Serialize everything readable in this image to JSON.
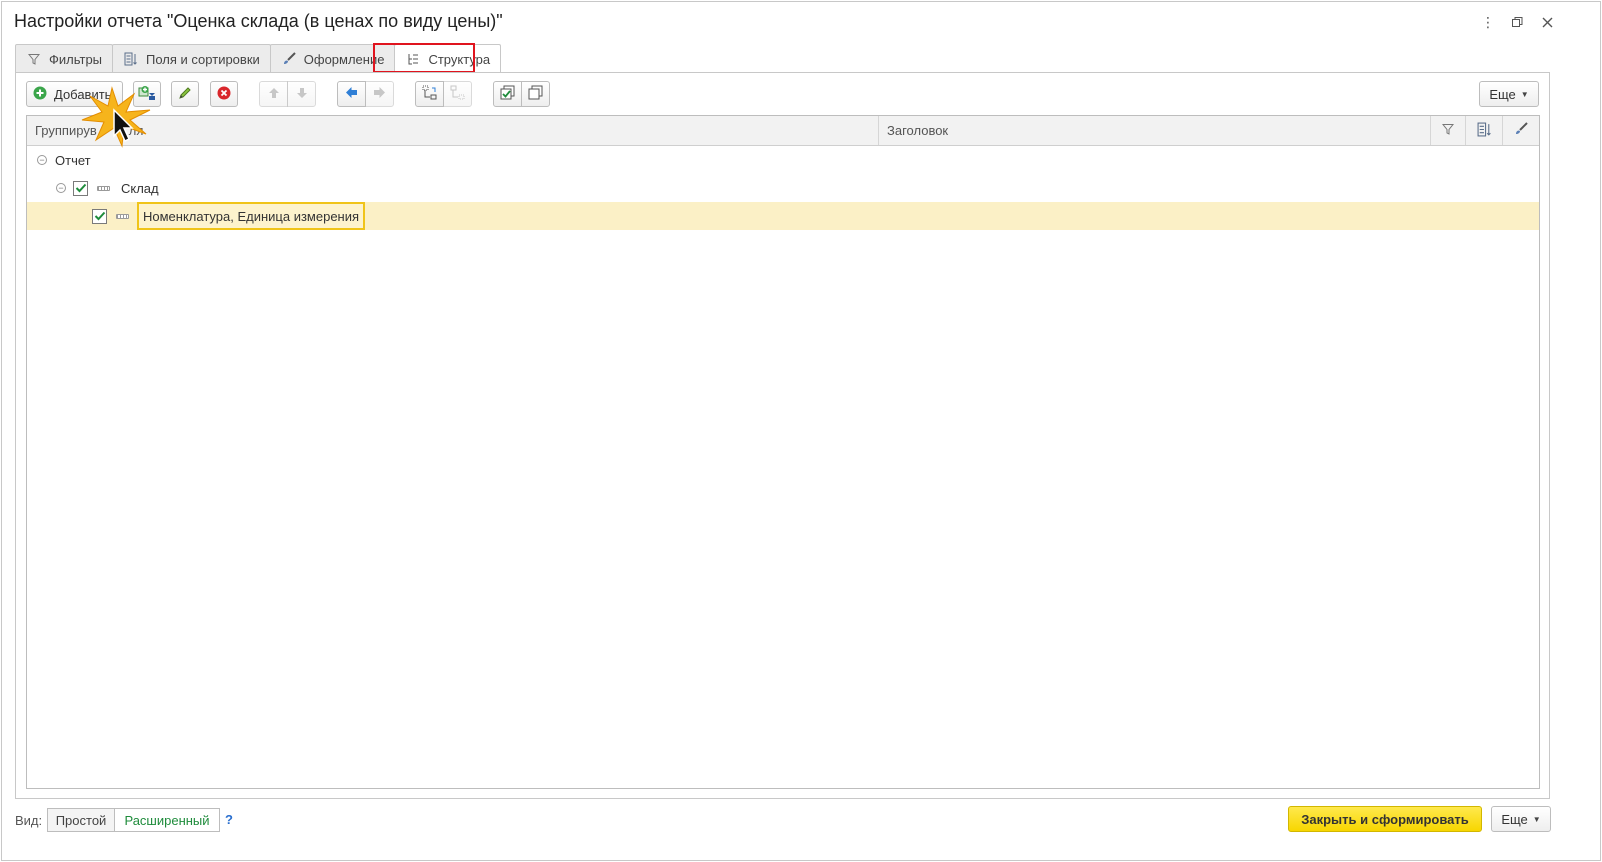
{
  "window": {
    "title": "Настройки отчета \"Оценка склада (в ценах по виду цены)\"",
    "controls": [
      "more-icon",
      "restore-icon",
      "close-icon"
    ]
  },
  "tabs": [
    {
      "label": "Фильтры",
      "icon": "filter-icon"
    },
    {
      "label": "Поля и сортировки",
      "icon": "fields-sort-icon"
    },
    {
      "label": "Оформление",
      "icon": "brush-icon"
    },
    {
      "label": "Структура",
      "icon": "structure-icon",
      "active": true
    }
  ],
  "toolbar": {
    "add_label": "Добавить",
    "more_label": "Еще",
    "icons": [
      "add-icon",
      "add-group-icon",
      "edit-icon",
      "delete-icon",
      "move-up-icon",
      "move-down-icon",
      "move-left-icon",
      "move-right-icon",
      "group-icon",
      "ungroup-icon",
      "check-all-icon",
      "uncheck-all-icon"
    ]
  },
  "table": {
    "columns": {
      "grouping": "Группирув",
      "grouping_tail": "ля",
      "title": "Заголовок"
    },
    "column_icons": [
      "filter-icon",
      "fields-sort-icon",
      "brush-icon"
    ],
    "rows": [
      {
        "label": "Отчет",
        "level": 0,
        "expanded": true,
        "checkbox": false
      },
      {
        "label": "Склад",
        "level": 1,
        "expanded": true,
        "checkbox": true,
        "checked": true
      },
      {
        "label": "Номенклатура, Единица измерения",
        "level": 2,
        "checkbox": true,
        "checked": true,
        "selected": true
      }
    ]
  },
  "footer": {
    "view_label": "Вид:",
    "view_options": [
      "Простой",
      "Расширенный"
    ],
    "active_view": "Расширенный",
    "help": "?",
    "primary_label": "Закрыть и сформировать",
    "more_label": "Еще"
  },
  "colors": {
    "accent_highlight": "#e0141e",
    "selection": "#fbf0c6",
    "primary_button": "#f7d600",
    "active_view": "#1f8c3c"
  }
}
